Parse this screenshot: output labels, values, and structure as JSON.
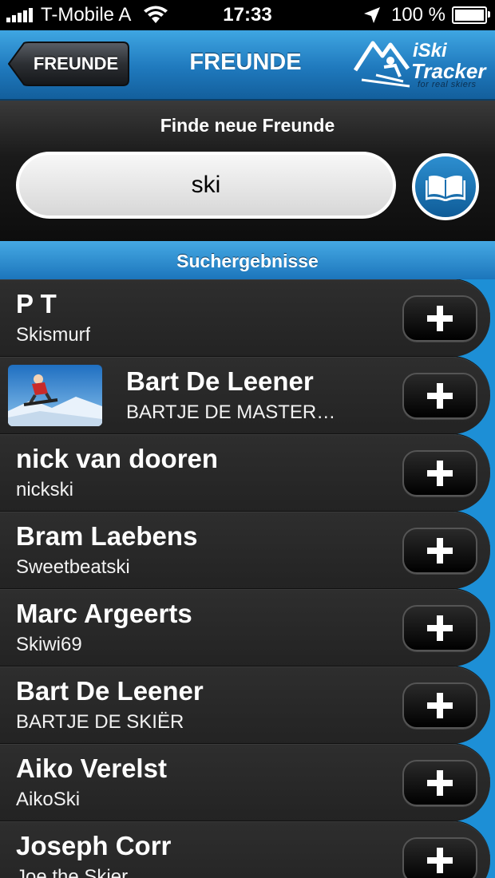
{
  "status_bar": {
    "carrier": "T-Mobile A",
    "time": "17:33",
    "battery": "100 %",
    "battery_level": 1.0,
    "icons": [
      "signal-icon",
      "wifi-icon",
      "location-arrow-icon",
      "battery-icon"
    ]
  },
  "navbar": {
    "back_label": "FREUNDE",
    "title": "FREUNDE",
    "logo_line1": "iSki",
    "logo_line2": "Tracker",
    "logo_tagline": "for real skiers"
  },
  "search": {
    "heading": "Finde neue Freunde",
    "value": "ski",
    "address_book_icon": "book-icon"
  },
  "results": {
    "header": "Suchergebnisse",
    "items": [
      {
        "name": "P T",
        "username": "Skismurf",
        "has_photo": false
      },
      {
        "name": "Bart De Leener",
        "username": "BARTJE DE MASTER…",
        "has_photo": true
      },
      {
        "name": "nick van dooren",
        "username": "nickski",
        "has_photo": false
      },
      {
        "name": "Bram Laebens",
        "username": "Sweetbeatski",
        "has_photo": false
      },
      {
        "name": "Marc Argeerts",
        "username": "Skiwi69",
        "has_photo": false
      },
      {
        "name": "Bart De Leener",
        "username": "BARTJE DE SKIËR",
        "has_photo": false
      },
      {
        "name": "Aiko Verelst",
        "username": "AikoSki",
        "has_photo": false
      },
      {
        "name": "Joseph Corr",
        "username": "Joe the Skier",
        "has_photo": false
      }
    ],
    "add_icon": "plus-icon"
  },
  "colors": {
    "accent_blue": "#1d8fd6",
    "row_dark": "#2a2a2a"
  }
}
